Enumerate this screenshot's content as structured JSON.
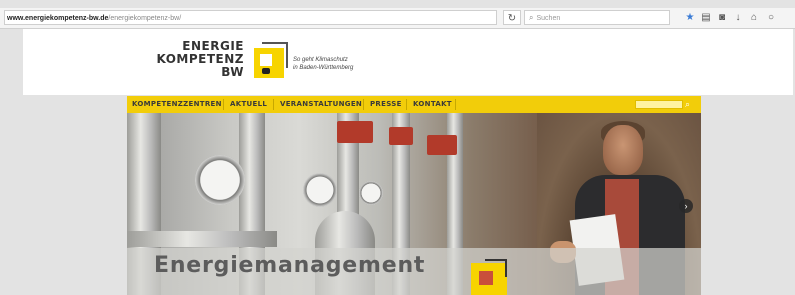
{
  "browser": {
    "url_host": "www.energiekompetenz-bw.de",
    "url_path": "/energiekompetenz-bw/",
    "reload_icon": "reload-icon",
    "search_placeholder": "Suchen",
    "toolbar_icons": [
      "star-icon",
      "clipboard-icon",
      "pocket-icon",
      "download-icon",
      "home-icon",
      "chat-icon"
    ]
  },
  "header": {
    "logo_line1": "ENERGIE",
    "logo_line2": "KOMPETENZ",
    "logo_line3": "BW",
    "tagline_line1": "So geht Klimaschutz",
    "tagline_line2": "in Baden-Württemberg"
  },
  "nav": {
    "items": [
      {
        "label": "KOMPETENZZENTREN"
      },
      {
        "label": "AKTUELL"
      },
      {
        "label": "VERANSTALTUNGEN"
      },
      {
        "label": "PRESSE"
      },
      {
        "label": "KONTAKT"
      }
    ],
    "search_icon": "search-icon"
  },
  "hero": {
    "caption": "Energiemanagement",
    "next_icon": "chevron-right-icon"
  },
  "colors": {
    "brand_yellow": "#f2cd0a",
    "accent_blue": "#3a7bd5"
  }
}
